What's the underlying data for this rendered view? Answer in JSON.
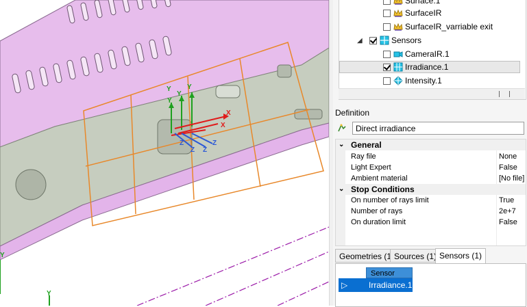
{
  "tree": {
    "items": [
      {
        "label": "Surface.1",
        "checked": false,
        "icon": "crown-surface-icon"
      },
      {
        "label": "SurfaceIR",
        "checked": false,
        "icon": "crown-surface-icon"
      },
      {
        "label": "SurfaceIR_varriable exit",
        "checked": false,
        "icon": "crown-surface-icon"
      },
      {
        "label": "Sensors",
        "checked": true,
        "icon": "sensors-folder-icon"
      },
      {
        "label": "CameraIR.1",
        "checked": false,
        "icon": "camera-icon"
      },
      {
        "label": "Irradiance.1",
        "checked": true,
        "icon": "irradiance-sensor-icon"
      },
      {
        "label": "Intensity.1",
        "checked": false,
        "icon": "intensity-sensor-icon"
      }
    ]
  },
  "definition": {
    "title": "Definition",
    "value": "Direct irradiance"
  },
  "properties": {
    "general": {
      "title": "General",
      "rows": [
        {
          "name": "Ray file",
          "value": "None"
        },
        {
          "name": "Light Expert",
          "value": "False"
        },
        {
          "name": "Ambient material",
          "value": "[No file]"
        }
      ]
    },
    "stop": {
      "title": "Stop Conditions",
      "rows": [
        {
          "name": "On number of rays limit",
          "value": "True"
        },
        {
          "name": "Number of rays",
          "value": "2e+7"
        },
        {
          "name": "On duration limit",
          "value": "False"
        }
      ]
    }
  },
  "tabs": [
    {
      "label": "Geometries (1)"
    },
    {
      "label": "Sources (1)"
    },
    {
      "label": "Sensors (1)"
    }
  ],
  "grid": {
    "header": "Sensor",
    "row": "Irradiance.1"
  },
  "viewport": {
    "axis_labels": [
      "Y",
      "Y",
      "Y",
      "Y",
      "X",
      "X",
      "Z",
      "Z",
      "Z",
      "Z",
      "Y",
      "Y"
    ]
  },
  "colors": {
    "selection": "#0a6fd1",
    "sensor_frame": "#e8882a",
    "model_body": "#e6b8ea",
    "model_face": "#c9cfc2"
  }
}
